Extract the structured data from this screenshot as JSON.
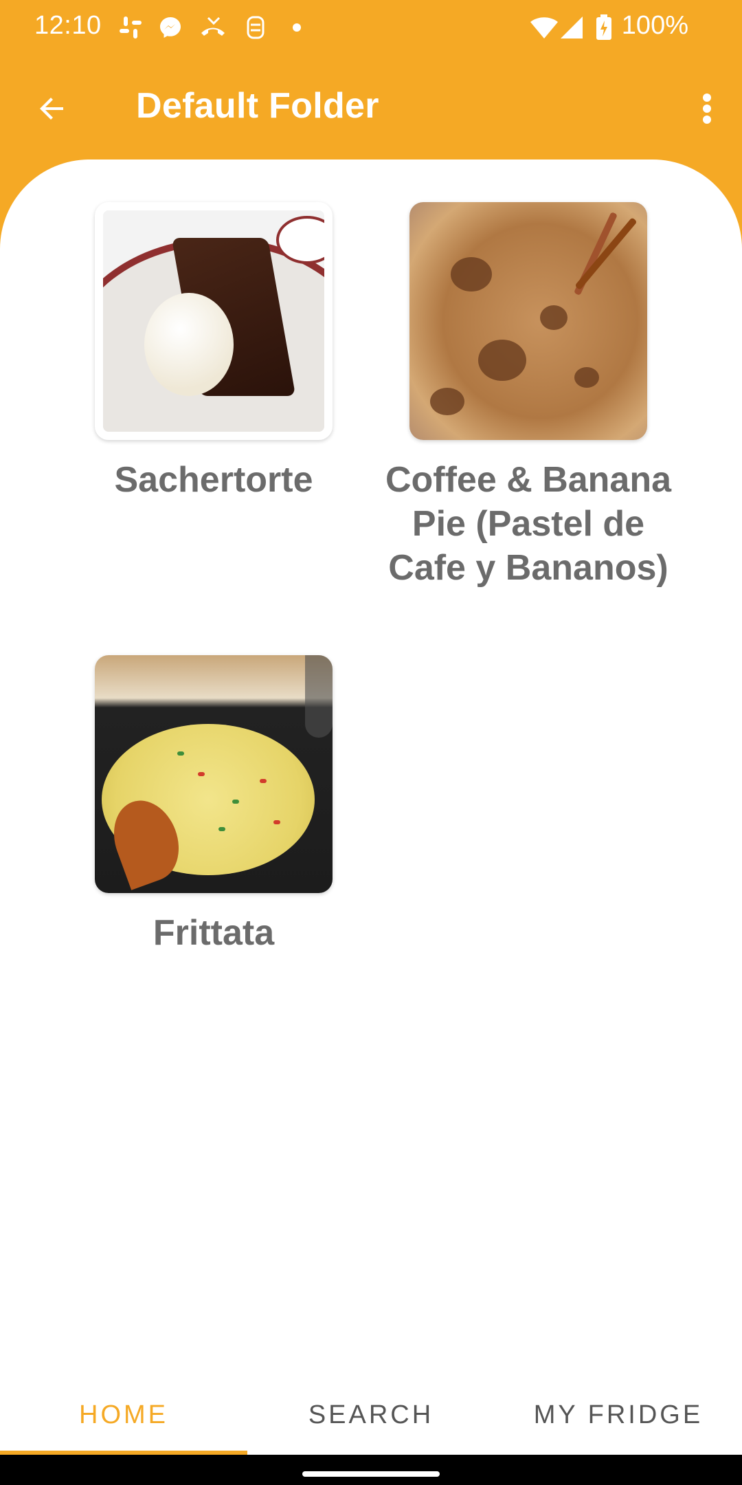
{
  "status_bar": {
    "time": "12:10",
    "battery": "100%",
    "icons": [
      "slack-icon",
      "messenger-icon",
      "missed-call-icon",
      "alert-icon",
      "dot-icon",
      "wifi-icon",
      "signal-icon",
      "battery-charging-icon"
    ]
  },
  "app_bar": {
    "title": "Default Folder",
    "back_icon": "arrow-left-icon",
    "menu_icon": "more-vertical-icon"
  },
  "recipes": [
    {
      "name": "Sachertorte"
    },
    {
      "name": "Coffee & Banana Pie (Pastel de Cafe y Bananos)"
    },
    {
      "name": "Frittata"
    }
  ],
  "bottom_nav": {
    "tabs": [
      {
        "label": "HOME",
        "active": true
      },
      {
        "label": "SEARCH",
        "active": false
      },
      {
        "label": "MY FRIDGE",
        "active": false
      }
    ]
  },
  "colors": {
    "accent": "#f5a925",
    "text_gray": "#6b6b6b",
    "nav_inactive": "#555555"
  }
}
